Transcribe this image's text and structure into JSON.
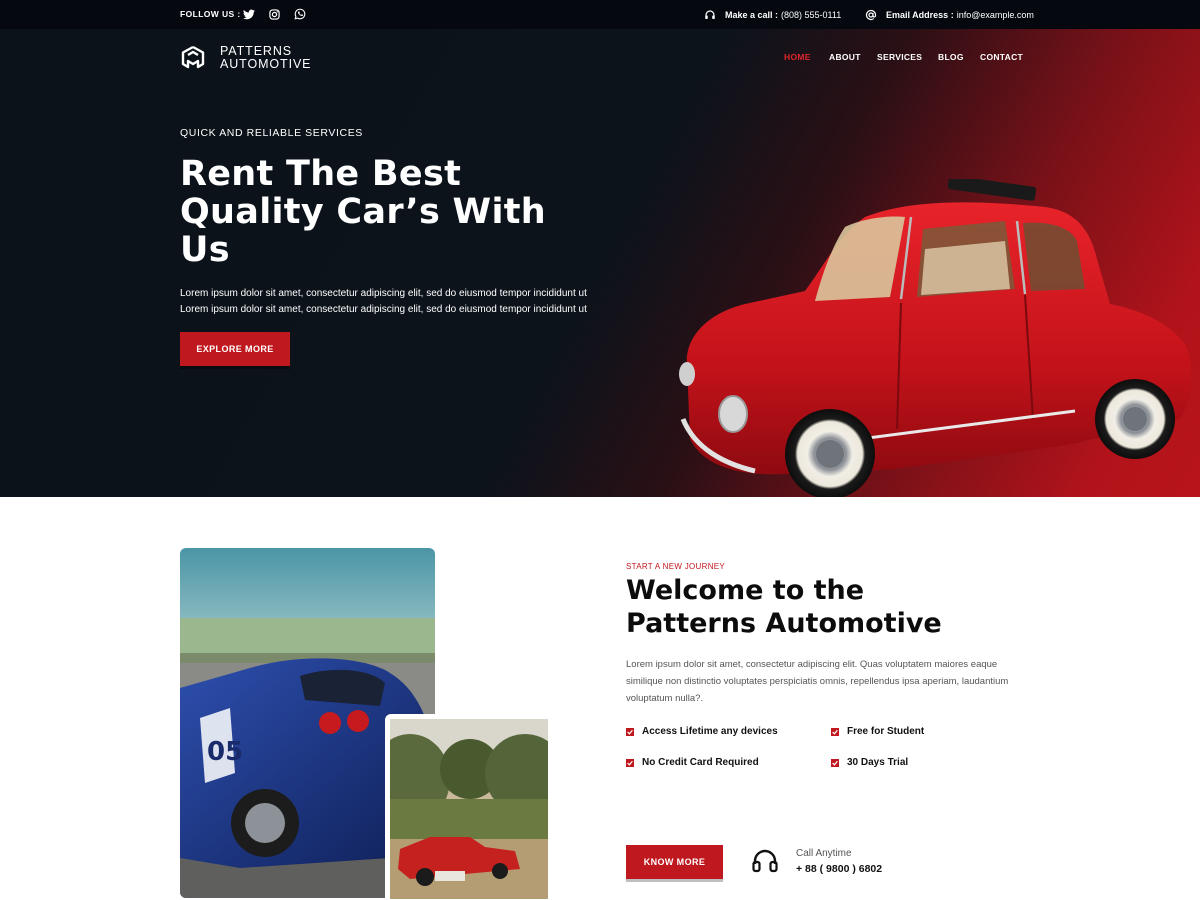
{
  "topbar": {
    "follow_label": "FOLLOW US :",
    "social": [
      {
        "icon": "twitter-icon"
      },
      {
        "icon": "instagram-icon"
      },
      {
        "icon": "whatsapp-icon"
      }
    ],
    "phone_label": "Make a call :",
    "phone_value": "(808) 555-0111",
    "email_label": "Email Address :",
    "email_value": "info@example.com"
  },
  "brand": {
    "line1": "PATTERNS",
    "line2": "AUTOMOTIVE"
  },
  "nav": {
    "items": [
      "HOME",
      "ABOUT",
      "SERVICES",
      "BLOG",
      "CONTACT"
    ],
    "active": "HOME"
  },
  "hero": {
    "eyebrow": "QUICK AND RELIABLE SERVICES",
    "title_line1": "Rent The Best",
    "title_line2": "Quality Car’s With",
    "title_line3": "Us",
    "desc_line1": "Lorem ipsum dolor sit amet, consectetur adipiscing elit, sed do eiusmod tempor incididunt ut",
    "desc_line2": "Lorem ipsum dolor sit amet, consectetur adipiscing elit, sed do eiusmod tempor incididunt ut",
    "cta": "EXPLORE MORE"
  },
  "about": {
    "eyebrow": "START A NEW JOURNEY",
    "title_line1": "Welcome to the",
    "title_line2": "Patterns Automotive",
    "desc": "Lorem ipsum dolor sit amet, consectetur adipiscing elit. Quas voluptatem maiores eaque similique non distinctio voluptates perspiciatis omnis, repellendus ipsa aperiam, laudantium voluptatum nulla?.",
    "features": [
      "Access Lifetime any devices",
      "Free for Student",
      "No Credit Card Required",
      "30 Days Trial"
    ],
    "cta": "KNOW MORE",
    "call_label": "Call Anytime",
    "call_number": "+ 88 ( 9800 ) 6802"
  },
  "colors": {
    "accent": "#c0181f",
    "dark": "#0b121a",
    "topbar": "#05090f"
  }
}
